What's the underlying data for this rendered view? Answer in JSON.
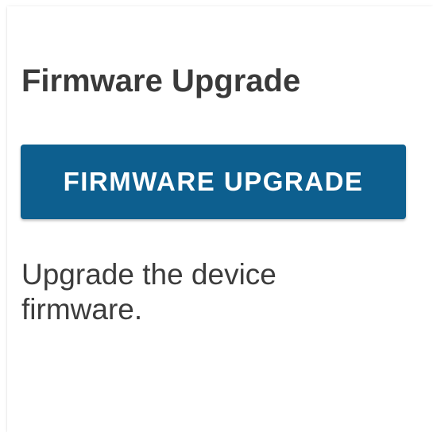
{
  "panel": {
    "title": "Firmware Upgrade",
    "button_label": "FIRMWARE UPGRADE",
    "description": "Upgrade the device firmware."
  },
  "colors": {
    "button_bg": "#0d5f8f",
    "button_text": "#ffffff",
    "text": "#3a3a3a"
  }
}
